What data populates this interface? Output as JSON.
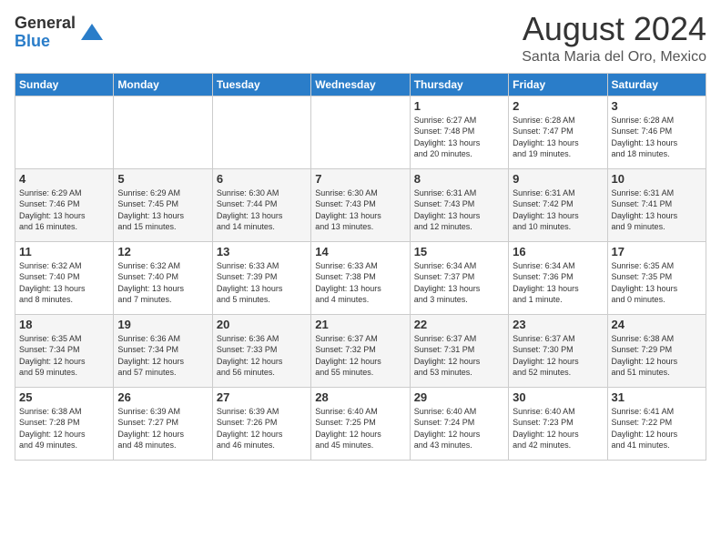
{
  "logo": {
    "general": "General",
    "blue": "Blue"
  },
  "title": "August 2024",
  "subtitle": "Santa Maria del Oro, Mexico",
  "days_header": [
    "Sunday",
    "Monday",
    "Tuesday",
    "Wednesday",
    "Thursday",
    "Friday",
    "Saturday"
  ],
  "weeks": [
    [
      {
        "day": "",
        "info": ""
      },
      {
        "day": "",
        "info": ""
      },
      {
        "day": "",
        "info": ""
      },
      {
        "day": "",
        "info": ""
      },
      {
        "day": "1",
        "info": "Sunrise: 6:27 AM\nSunset: 7:48 PM\nDaylight: 13 hours\nand 20 minutes."
      },
      {
        "day": "2",
        "info": "Sunrise: 6:28 AM\nSunset: 7:47 PM\nDaylight: 13 hours\nand 19 minutes."
      },
      {
        "day": "3",
        "info": "Sunrise: 6:28 AM\nSunset: 7:46 PM\nDaylight: 13 hours\nand 18 minutes."
      }
    ],
    [
      {
        "day": "4",
        "info": "Sunrise: 6:29 AM\nSunset: 7:46 PM\nDaylight: 13 hours\nand 16 minutes."
      },
      {
        "day": "5",
        "info": "Sunrise: 6:29 AM\nSunset: 7:45 PM\nDaylight: 13 hours\nand 15 minutes."
      },
      {
        "day": "6",
        "info": "Sunrise: 6:30 AM\nSunset: 7:44 PM\nDaylight: 13 hours\nand 14 minutes."
      },
      {
        "day": "7",
        "info": "Sunrise: 6:30 AM\nSunset: 7:43 PM\nDaylight: 13 hours\nand 13 minutes."
      },
      {
        "day": "8",
        "info": "Sunrise: 6:31 AM\nSunset: 7:43 PM\nDaylight: 13 hours\nand 12 minutes."
      },
      {
        "day": "9",
        "info": "Sunrise: 6:31 AM\nSunset: 7:42 PM\nDaylight: 13 hours\nand 10 minutes."
      },
      {
        "day": "10",
        "info": "Sunrise: 6:31 AM\nSunset: 7:41 PM\nDaylight: 13 hours\nand 9 minutes."
      }
    ],
    [
      {
        "day": "11",
        "info": "Sunrise: 6:32 AM\nSunset: 7:40 PM\nDaylight: 13 hours\nand 8 minutes."
      },
      {
        "day": "12",
        "info": "Sunrise: 6:32 AM\nSunset: 7:40 PM\nDaylight: 13 hours\nand 7 minutes."
      },
      {
        "day": "13",
        "info": "Sunrise: 6:33 AM\nSunset: 7:39 PM\nDaylight: 13 hours\nand 5 minutes."
      },
      {
        "day": "14",
        "info": "Sunrise: 6:33 AM\nSunset: 7:38 PM\nDaylight: 13 hours\nand 4 minutes."
      },
      {
        "day": "15",
        "info": "Sunrise: 6:34 AM\nSunset: 7:37 PM\nDaylight: 13 hours\nand 3 minutes."
      },
      {
        "day": "16",
        "info": "Sunrise: 6:34 AM\nSunset: 7:36 PM\nDaylight: 13 hours\nand 1 minute."
      },
      {
        "day": "17",
        "info": "Sunrise: 6:35 AM\nSunset: 7:35 PM\nDaylight: 13 hours\nand 0 minutes."
      }
    ],
    [
      {
        "day": "18",
        "info": "Sunrise: 6:35 AM\nSunset: 7:34 PM\nDaylight: 12 hours\nand 59 minutes."
      },
      {
        "day": "19",
        "info": "Sunrise: 6:36 AM\nSunset: 7:34 PM\nDaylight: 12 hours\nand 57 minutes."
      },
      {
        "day": "20",
        "info": "Sunrise: 6:36 AM\nSunset: 7:33 PM\nDaylight: 12 hours\nand 56 minutes."
      },
      {
        "day": "21",
        "info": "Sunrise: 6:37 AM\nSunset: 7:32 PM\nDaylight: 12 hours\nand 55 minutes."
      },
      {
        "day": "22",
        "info": "Sunrise: 6:37 AM\nSunset: 7:31 PM\nDaylight: 12 hours\nand 53 minutes."
      },
      {
        "day": "23",
        "info": "Sunrise: 6:37 AM\nSunset: 7:30 PM\nDaylight: 12 hours\nand 52 minutes."
      },
      {
        "day": "24",
        "info": "Sunrise: 6:38 AM\nSunset: 7:29 PM\nDaylight: 12 hours\nand 51 minutes."
      }
    ],
    [
      {
        "day": "25",
        "info": "Sunrise: 6:38 AM\nSunset: 7:28 PM\nDaylight: 12 hours\nand 49 minutes."
      },
      {
        "day": "26",
        "info": "Sunrise: 6:39 AM\nSunset: 7:27 PM\nDaylight: 12 hours\nand 48 minutes."
      },
      {
        "day": "27",
        "info": "Sunrise: 6:39 AM\nSunset: 7:26 PM\nDaylight: 12 hours\nand 46 minutes."
      },
      {
        "day": "28",
        "info": "Sunrise: 6:40 AM\nSunset: 7:25 PM\nDaylight: 12 hours\nand 45 minutes."
      },
      {
        "day": "29",
        "info": "Sunrise: 6:40 AM\nSunset: 7:24 PM\nDaylight: 12 hours\nand 43 minutes."
      },
      {
        "day": "30",
        "info": "Sunrise: 6:40 AM\nSunset: 7:23 PM\nDaylight: 12 hours\nand 42 minutes."
      },
      {
        "day": "31",
        "info": "Sunrise: 6:41 AM\nSunset: 7:22 PM\nDaylight: 12 hours\nand 41 minutes."
      }
    ]
  ]
}
